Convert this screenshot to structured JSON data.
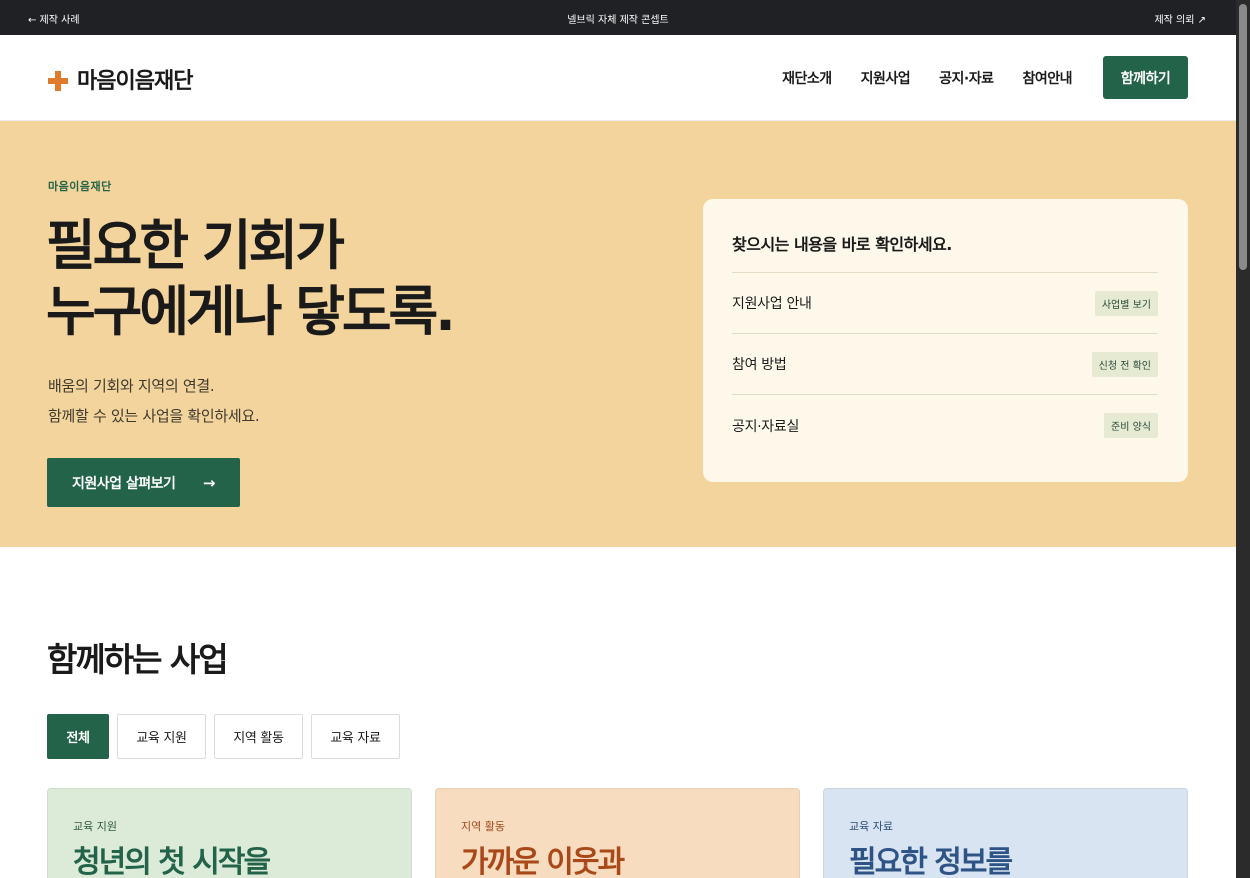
{
  "topbar": {
    "back_label": "← 제작 사례",
    "center_label": "넬브릭 자체 제작 콘셉트",
    "request_label": "제작 의뢰 ↗"
  },
  "header": {
    "logo_text": "마음이음재단",
    "nav": [
      "재단소개",
      "지원사업",
      "공지·자료",
      "참여안내"
    ],
    "cta_label": "함께하기"
  },
  "hero": {
    "eyebrow": "마음이음재단",
    "title_line1": "필요한 기회가",
    "title_line2": "누구에게나 닿도록.",
    "desc_line1": "배움의 기회와 지역의 연결.",
    "desc_line2": "함께할 수 있는 사업을 확인하세요.",
    "button_label": "지원사업 살펴보기",
    "button_arrow": "→"
  },
  "quick_panel": {
    "title": "찾으시는 내용을 바로 확인하세요.",
    "rows": [
      {
        "label": "지원사업 안내",
        "tag": "사업별 보기"
      },
      {
        "label": "참여 방법",
        "tag": "신청 전 확인"
      },
      {
        "label": "공지·자료실",
        "tag": "준비 양식"
      }
    ]
  },
  "programs": {
    "title": "함께하는 사업",
    "filters": [
      "전체",
      "교육 지원",
      "지역 활동",
      "교육 자료"
    ],
    "active_filter": "전체",
    "cards": [
      {
        "category": "교육 지원",
        "title": "청년의 첫 시작을"
      },
      {
        "category": "지역 활동",
        "title": "가까운 이웃과"
      },
      {
        "category": "교육 자료",
        "title": "필요한 정보를"
      }
    ]
  },
  "colors": {
    "brand_green": "#23634a",
    "accent_orange": "#e07b2c",
    "hero_bg": "#f3d49c",
    "panel_bg": "#fdf8ea"
  }
}
